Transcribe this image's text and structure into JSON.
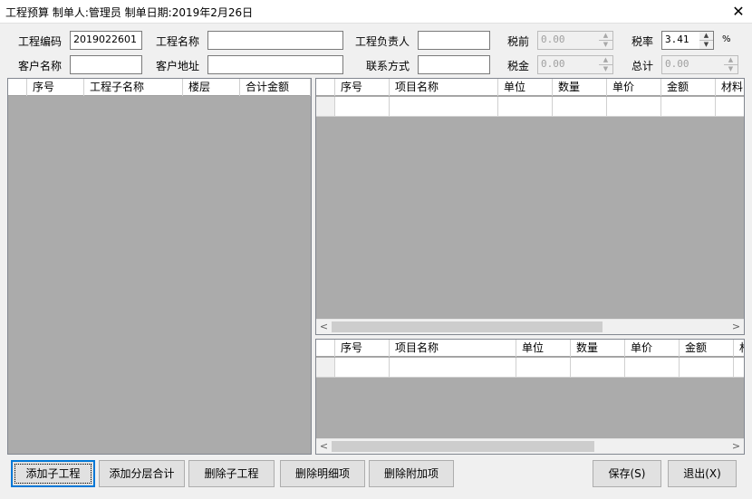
{
  "window": {
    "title": "工程预算 制单人:管理员 制单日期:2019年2月26日",
    "close_symbol": "✕"
  },
  "form": {
    "project_code_label": "工程编码",
    "project_code_value": "2019022601",
    "project_name_label": "工程名称",
    "project_name_value": "",
    "project_manager_label": "工程负责人",
    "project_manager_value": "",
    "pre_tax_label": "税前",
    "pre_tax_value": "0.00",
    "tax_rate_label": "税率",
    "tax_rate_value": "3.41",
    "percent_sign": "%",
    "customer_name_label": "客户名称",
    "customer_name_value": "",
    "customer_address_label": "客户地址",
    "customer_address_value": "",
    "contact_label": "联系方式",
    "contact_value": "",
    "tax_label": "税金",
    "tax_value": "0.00",
    "total_label": "总计",
    "total_value": "0.00"
  },
  "left_grid": {
    "columns": [
      "",
      "序号",
      "工程子名称",
      "楼层",
      "合计金额"
    ]
  },
  "detail_grid": {
    "columns": [
      "",
      "序号",
      "项目名称",
      "单位",
      "数量",
      "单价",
      "金额",
      "材料"
    ]
  },
  "extra_grid": {
    "columns": [
      "",
      "序号",
      "项目名称",
      "单位",
      "数量",
      "单价",
      "金额",
      "材"
    ]
  },
  "scroll": {
    "left_arrow": "<",
    "right_arrow": ">"
  },
  "spin": {
    "up": "▲",
    "down": "▼"
  },
  "buttons": {
    "add_sub": "添加子工程",
    "add_floor": "添加分层合计",
    "del_sub": "删除子工程",
    "del_detail": "删除明细项",
    "del_extra": "删除附加项",
    "save": "保存(S)",
    "exit": "退出(X)"
  }
}
